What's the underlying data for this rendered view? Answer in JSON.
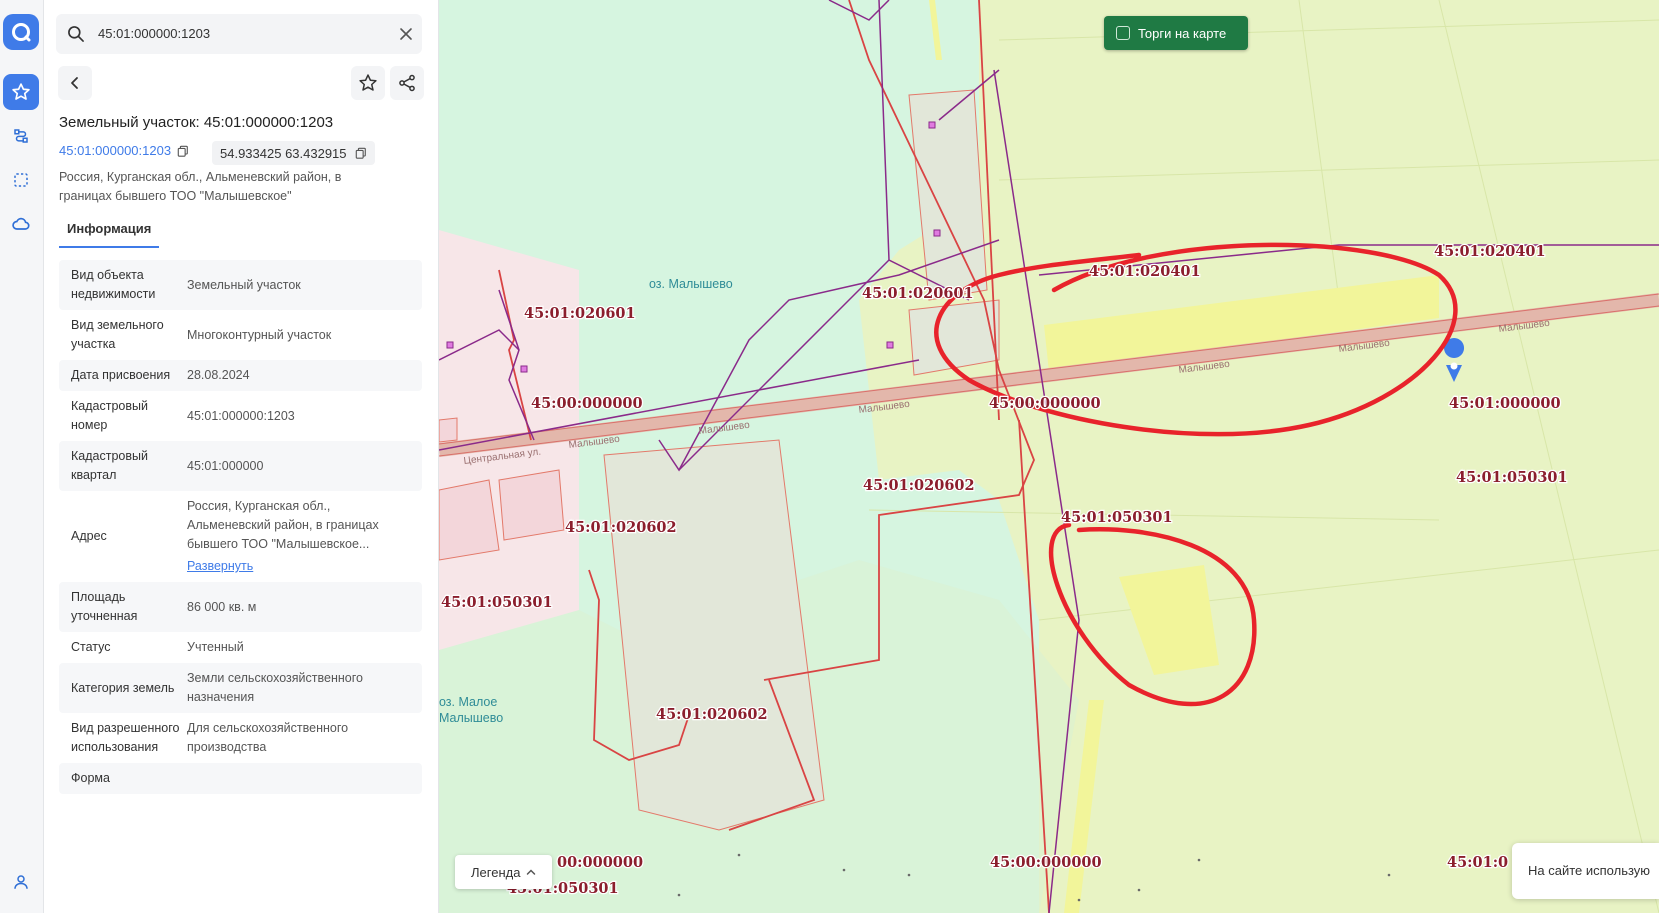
{
  "rail": {
    "items": [
      "favorites",
      "routes",
      "selection",
      "layers"
    ]
  },
  "search": {
    "value": "45:01:000000:1203"
  },
  "object": {
    "title": "Земельный участок: 45:01:000000:1203",
    "cad_number": "45:01:000000:1203",
    "coords": "54.933425 63.432915",
    "address_short": "Россия, Курганская обл., Альменевский район, в границах бывшего ТОО \"Малышевское\""
  },
  "tabs": {
    "info": "Информация"
  },
  "rows": [
    {
      "key": "Вид объекта недвижимости",
      "value": "Земельный участок"
    },
    {
      "key": "Вид земельного участка",
      "value": "Многоконтурный участок"
    },
    {
      "key": "Дата присвоения",
      "value": "28.08.2024"
    },
    {
      "key": "Кадастровый номер",
      "value": "45:01:000000:1203"
    },
    {
      "key": "Кадастровый квартал",
      "value": "45:01:000000"
    },
    {
      "key": "Адрес",
      "value": "Россия, Курганская обл., Альменевский район, в границах бывшего ТОО \"Малышевское...",
      "link": "Развернуть"
    },
    {
      "key": "Площадь уточненная",
      "value": "86 000 кв. м"
    },
    {
      "key": "Статус",
      "value": "Учтенный"
    },
    {
      "key": "Категория земель",
      "value": "Земли сельскохозяйственного назначения"
    },
    {
      "key": "Вид разрешенного использования",
      "value": "Для сельскохозяйственного производства"
    },
    {
      "key": "Форма",
      "value": ""
    }
  ],
  "map": {
    "torgi_label": "Торги на карте",
    "legend_label": "Легенда",
    "cookie_text": "На сайте использую",
    "lakes": [
      "оз. Малышево",
      "оз. Малое",
      "Малышево"
    ],
    "road_labels": [
      "Малышево",
      "Малышево",
      "Малышево",
      "Малышево",
      "Малышево",
      "Малышево",
      "Центральная ул."
    ],
    "cad_labels": [
      "45:01:020601",
      "45:01:020601",
      "45:01:020401",
      "45:01:020401",
      "45:00:000000",
      "45:00:000000",
      "45:01:000000",
      "45:01:050301",
      "45:01:020602",
      "45:01:020602",
      "45:01:050301",
      "45:01:050301",
      "45:01:020602",
      "00:000000",
      "45:01:050301",
      "45:00:000000",
      "45:01:0"
    ],
    "colors": {
      "meadow": "#d6f5e0",
      "field": "#e8f3c4",
      "parcel": "#f2f59a",
      "boundary": "#d94444",
      "lines": "#8a2a8a",
      "highlight": "#e8232b"
    }
  }
}
